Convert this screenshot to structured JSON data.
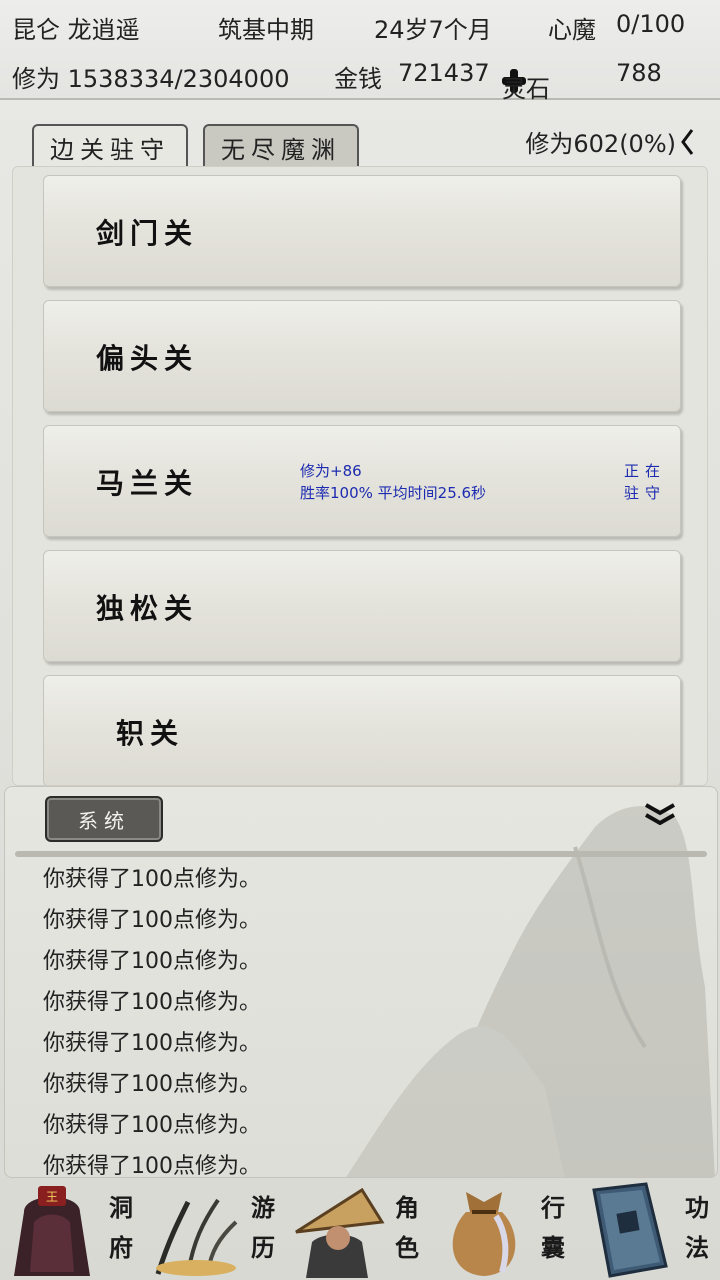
{
  "status": {
    "player": "昆仑 龙逍遥",
    "realm": "筑基中期",
    "age": "24岁7个月",
    "demon_label": "心魔",
    "demon_value": "0/100",
    "cultivation": "修为 1538334/2304000",
    "money_label": "金钱",
    "money_value": "721437",
    "spirit_label": "灵石",
    "spirit_value": "788"
  },
  "tabs": [
    {
      "label": "边关驻守",
      "active": true
    },
    {
      "label": "无尽魔渊",
      "active": false
    }
  ],
  "cultivation_rate": "修为602(0%)",
  "passes": [
    {
      "name": "剑门关"
    },
    {
      "name": "偏头关"
    },
    {
      "name": "马兰关",
      "reward": "修为+86",
      "stats": "胜率100% 平均时间25.6秒",
      "guard_line1": "正在",
      "guard_line2": "驻守"
    },
    {
      "name": "独松关"
    },
    {
      "name": "轵关"
    }
  ],
  "log": {
    "channel": "系统",
    "lines": [
      "你获得了100点修为。",
      "你获得了100点修为。",
      "你获得了100点修为。",
      "你获得了100点修为。",
      "你获得了100点修为。",
      "你获得了100点修为。",
      "你获得了100点修为。",
      "你获得了100点修为。"
    ]
  },
  "nav": [
    {
      "label_top": "洞",
      "label_bottom": "府",
      "icon": "cave-dwelling-icon"
    },
    {
      "label_top": "游",
      "label_bottom": "历",
      "icon": "travel-icon"
    },
    {
      "label_top": "角",
      "label_bottom": "色",
      "icon": "character-icon"
    },
    {
      "label_top": "行",
      "label_bottom": "囊",
      "icon": "bag-icon"
    },
    {
      "label_top": "功",
      "label_bottom": "法",
      "icon": "technique-book-icon"
    }
  ],
  "colors": {
    "accent_blue": "#1d2bb0",
    "panel": "#e4e4de",
    "button_dark": "#5a5955"
  }
}
